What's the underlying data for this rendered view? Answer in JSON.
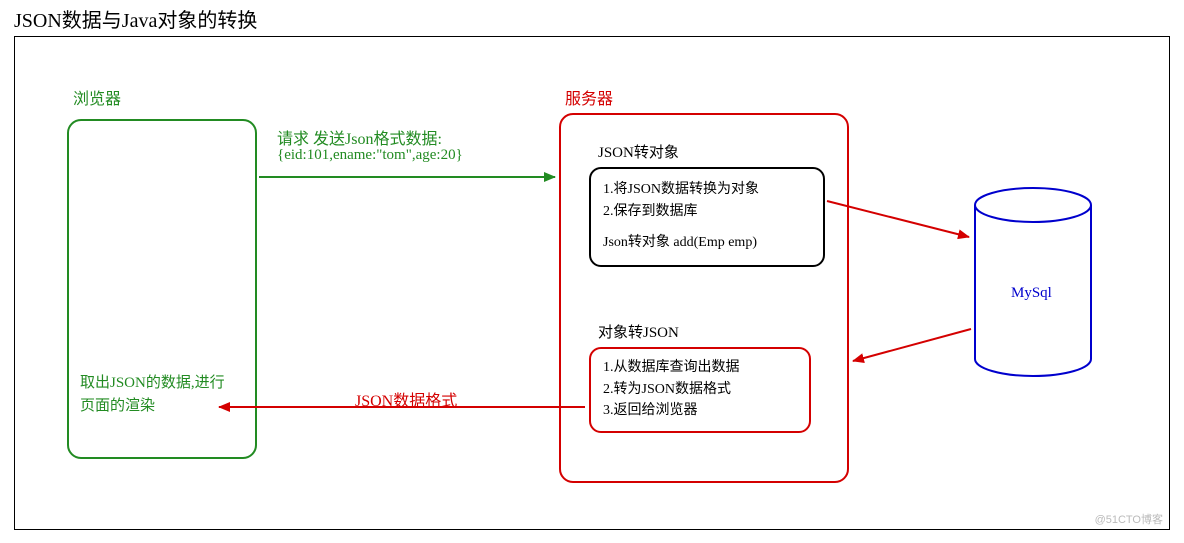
{
  "title": "JSON数据与Java对象的转换",
  "browser": {
    "label": "浏览器",
    "render_text_l1": "取出JSON的数据,进行",
    "render_text_l2": "页面的渲染"
  },
  "server": {
    "label": "服务器"
  },
  "request": {
    "line1": "请求 发送Json格式数据:",
    "line2": "{eid:101,ename:\"tom\",age:20}"
  },
  "response": {
    "label": "JSON数据格式"
  },
  "json2obj": {
    "heading": "JSON转对象",
    "line1": "1.将JSON数据转换为对象",
    "line2": "2.保存到数据库",
    "line3": "Json转对象 add(Emp emp)"
  },
  "obj2json": {
    "heading": "对象转JSON",
    "line1": "1.从数据库查询出数据",
    "line2": "2.转为JSON数据格式",
    "line3": "3.返回给浏览器"
  },
  "db": {
    "label": "MySql"
  },
  "watermark": "@51CTO博客"
}
